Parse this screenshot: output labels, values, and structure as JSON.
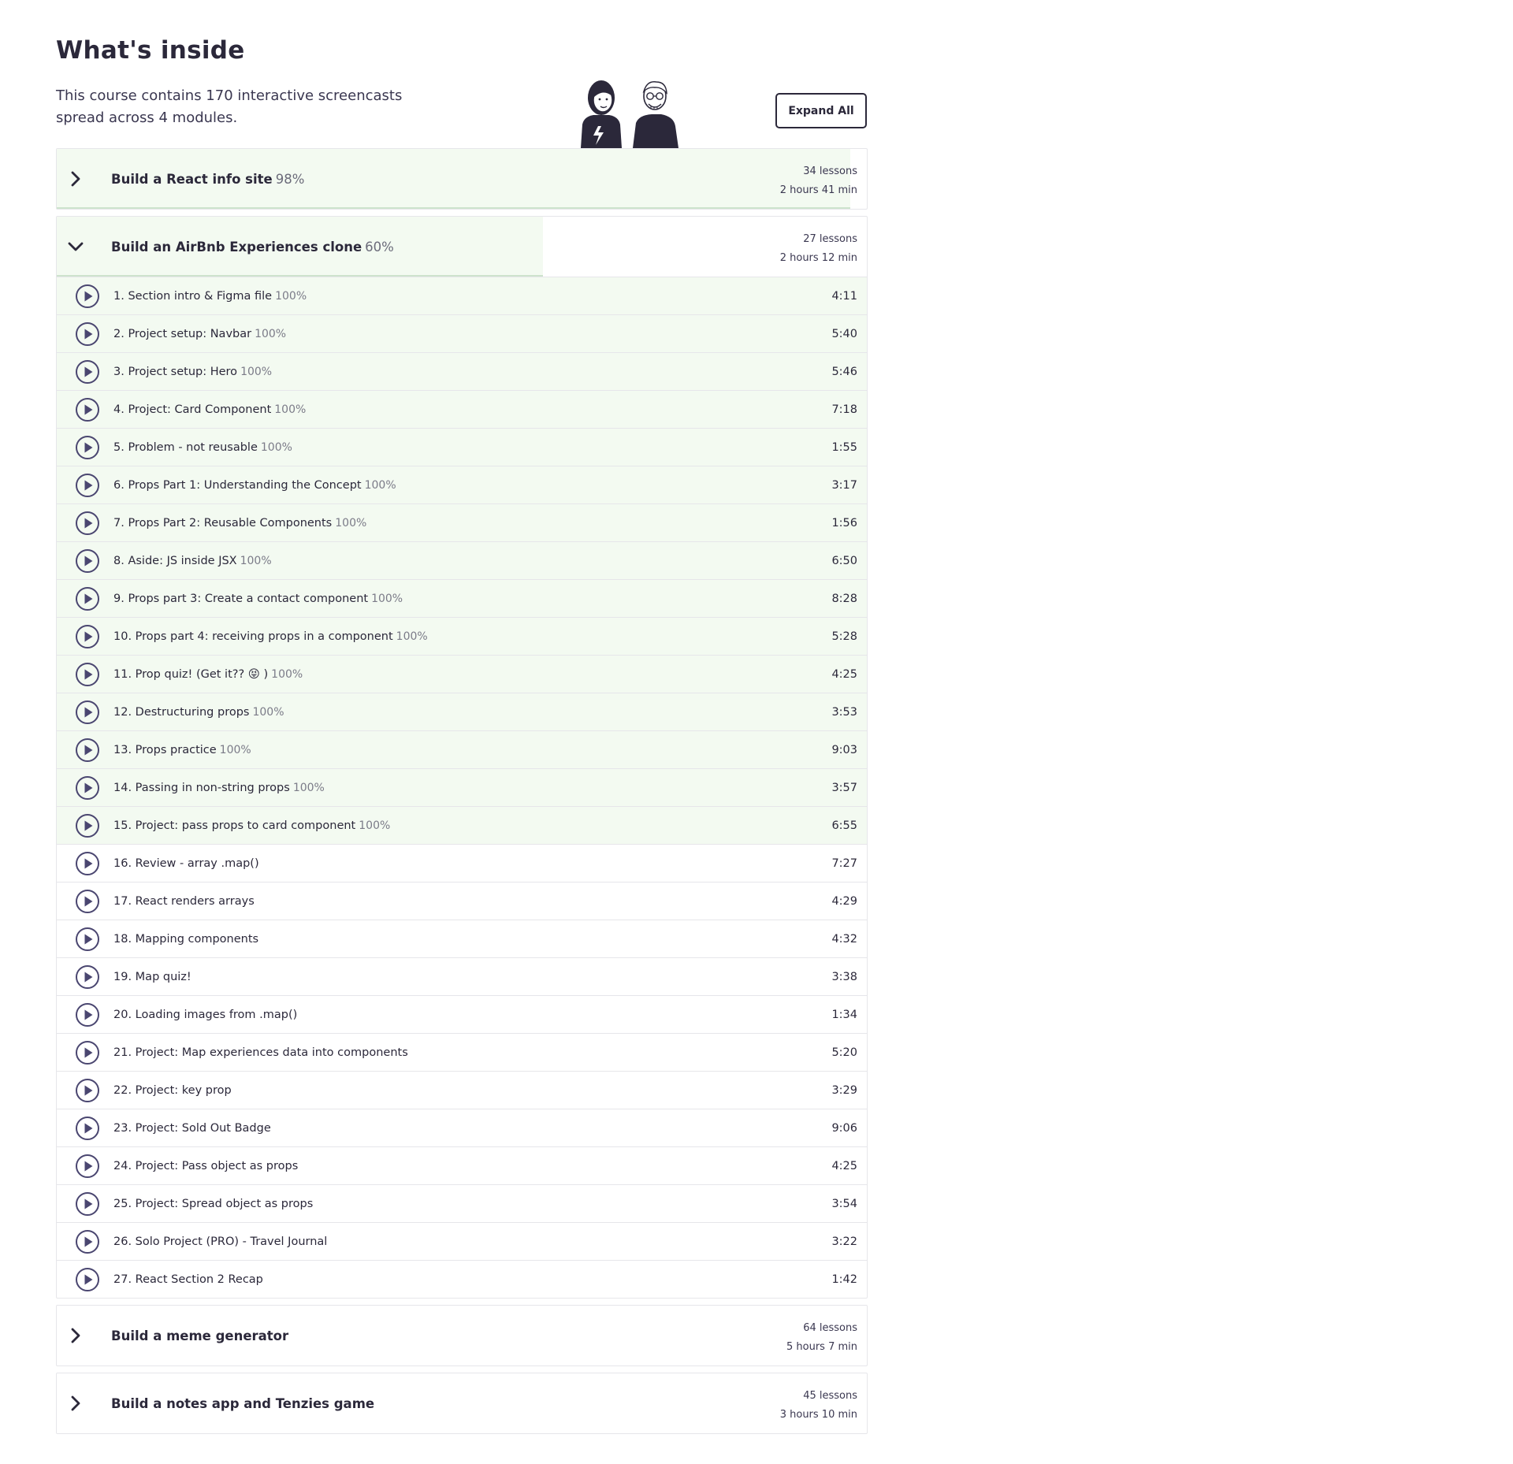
{
  "page": {
    "title": "What's inside",
    "intro": "This course contains 170 interactive screencasts spread across 4 modules.",
    "expand_label": "Expand All"
  },
  "colors": {
    "progress_fill": "#f3faf1",
    "progress_border": "#cde3cd",
    "ink": "#2b283a",
    "icon": "#4a4670"
  },
  "modules": [
    {
      "title": "Build a React info site",
      "percent_label": "98%",
      "progress": 0.98,
      "lessons_count": "34 lessons",
      "duration": "2 hours 41 min",
      "expanded": false,
      "icon": "chevron-right-icon"
    },
    {
      "title": "Build an AirBnb Experiences clone",
      "percent_label": "60%",
      "progress": 0.6,
      "lessons_count": "27 lessons",
      "duration": "2 hours 12 min",
      "expanded": true,
      "icon": "chevron-down-icon",
      "lessons": [
        {
          "title": "1. Section intro & Figma file",
          "percent": "100%",
          "duration": "4:11",
          "done": true
        },
        {
          "title": "2. Project setup: Navbar",
          "percent": "100%",
          "duration": "5:40",
          "done": true
        },
        {
          "title": "3. Project setup: Hero",
          "percent": "100%",
          "duration": "5:46",
          "done": true
        },
        {
          "title": "4. Project: Card Component",
          "percent": "100%",
          "duration": "7:18",
          "done": true
        },
        {
          "title": "5. Problem - not reusable",
          "percent": "100%",
          "duration": "1:55",
          "done": true
        },
        {
          "title": "6. Props Part 1: Understanding the Concept",
          "percent": "100%",
          "duration": "3:17",
          "done": true
        },
        {
          "title": "7. Props Part 2: Reusable Components",
          "percent": "100%",
          "duration": "1:56",
          "done": true
        },
        {
          "title": "8. Aside: JS inside JSX",
          "percent": "100%",
          "duration": "6:50",
          "done": true
        },
        {
          "title": "9. Props part 3: Create a contact component",
          "percent": "100%",
          "duration": "8:28",
          "done": true
        },
        {
          "title": "10. Props part 4: receiving props in a component",
          "percent": "100%",
          "duration": "5:28",
          "done": true
        },
        {
          "title": "11. Prop quiz! (Get it?? 😝 )",
          "percent": "100%",
          "duration": "4:25",
          "done": true
        },
        {
          "title": "12. Destructuring props",
          "percent": "100%",
          "duration": "3:53",
          "done": true
        },
        {
          "title": "13. Props practice",
          "percent": "100%",
          "duration": "9:03",
          "done": true
        },
        {
          "title": "14. Passing in non-string props",
          "percent": "100%",
          "duration": "3:57",
          "done": true
        },
        {
          "title": "15. Project: pass props to card component",
          "percent": "100%",
          "duration": "6:55",
          "done": true
        },
        {
          "title": "16. Review - array .map()",
          "percent": "",
          "duration": "7:27",
          "done": false
        },
        {
          "title": "17. React renders arrays",
          "percent": "",
          "duration": "4:29",
          "done": false
        },
        {
          "title": "18. Mapping components",
          "percent": "",
          "duration": "4:32",
          "done": false
        },
        {
          "title": "19. Map quiz!",
          "percent": "",
          "duration": "3:38",
          "done": false
        },
        {
          "title": "20. Loading images from .map()",
          "percent": "",
          "duration": "1:34",
          "done": false
        },
        {
          "title": "21. Project: Map experiences data into components",
          "percent": "",
          "duration": "5:20",
          "done": false
        },
        {
          "title": "22. Project: key prop",
          "percent": "",
          "duration": "3:29",
          "done": false
        },
        {
          "title": "23. Project: Sold Out Badge",
          "percent": "",
          "duration": "9:06",
          "done": false
        },
        {
          "title": "24. Project: Pass object as props",
          "percent": "",
          "duration": "4:25",
          "done": false
        },
        {
          "title": "25. Project: Spread object as props",
          "percent": "",
          "duration": "3:54",
          "done": false
        },
        {
          "title": "26. Solo Project (PRO) - Travel Journal",
          "percent": "",
          "duration": "3:22",
          "done": false
        },
        {
          "title": "27. React Section 2 Recap",
          "percent": "",
          "duration": "1:42",
          "done": false
        }
      ]
    },
    {
      "title": "Build a meme generator",
      "percent_label": "",
      "progress": 0,
      "lessons_count": "64 lessons",
      "duration": "5 hours 7 min",
      "expanded": false,
      "icon": "chevron-right-icon"
    },
    {
      "title": "Build a notes app and Tenzies game",
      "percent_label": "",
      "progress": 0,
      "lessons_count": "45 lessons",
      "duration": "3 hours 10 min",
      "expanded": false,
      "icon": "chevron-right-icon"
    }
  ]
}
